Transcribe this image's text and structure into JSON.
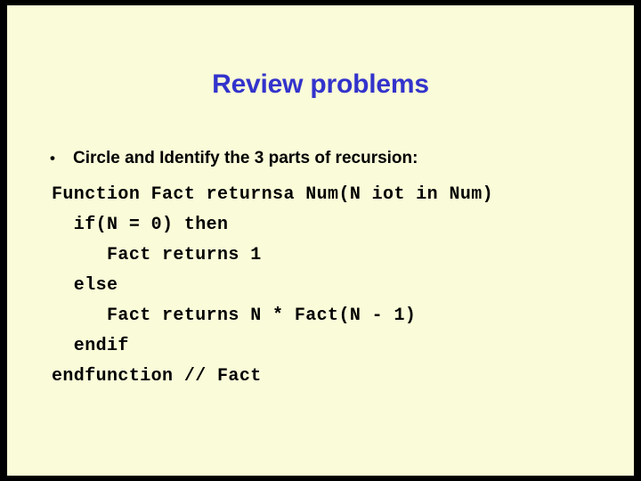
{
  "slide": {
    "title": "Review problems",
    "background_color": "#FAFBD8",
    "border_color": "#000000",
    "title_color": "#3333CC",
    "body_color": "#000000"
  },
  "bullets": [
    {
      "marker": "•",
      "text": "Circle and Identify the 3 parts of recursion:"
    }
  ],
  "code": {
    "language_hint": "pseudocode",
    "lines": [
      "Function Fact returnsa Num(N iot in Num)",
      "  if(N = 0) then",
      "     Fact returns 1",
      "  else",
      "     Fact returns N * Fact(N - 1)",
      "  endif",
      "endfunction // Fact"
    ]
  }
}
